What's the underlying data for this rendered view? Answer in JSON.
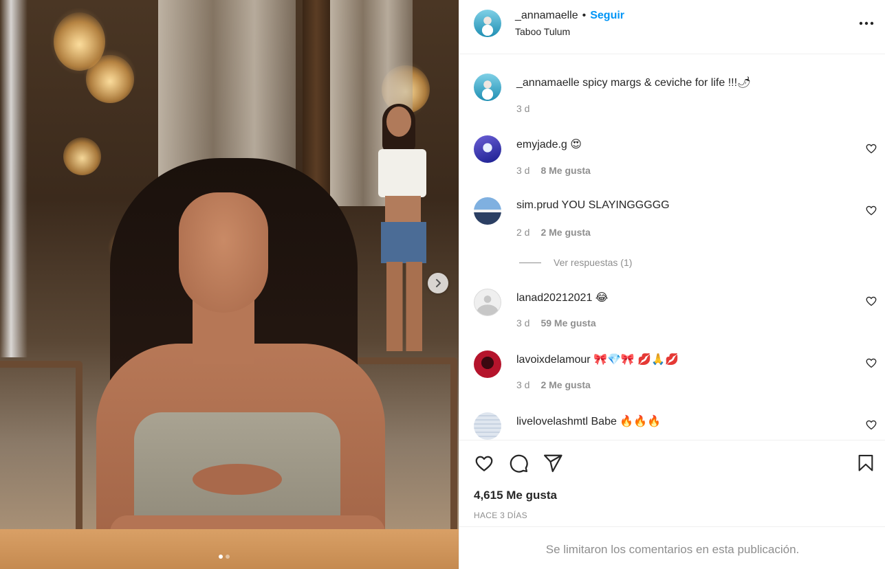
{
  "post": {
    "username": "_annamaelle",
    "separator": "•",
    "follow_label": "Seguir",
    "location": "Taboo Tulum",
    "more_icon": "ellipsis-icon",
    "carousel": {
      "total_images": 2,
      "current_index": 1,
      "next_icon": "chevron-right-icon"
    }
  },
  "caption": {
    "username": "_annamaelle",
    "text": "spicy margs & ceviche for life !!!🌶",
    "time": "3 d"
  },
  "comments": [
    {
      "username": "emyjade.g",
      "text": "😍",
      "time": "3 d",
      "likes": "8 Me gusta"
    },
    {
      "username": "sim.prud",
      "text": "YOU SLAYINGGGGG",
      "time": "2 d",
      "likes": "2 Me gusta",
      "replies_label": "Ver respuestas (1)"
    },
    {
      "username": "lanad20212021",
      "text": "😂",
      "time": "3 d",
      "likes": "59 Me gusta"
    },
    {
      "username": "lavoixdelamour",
      "text": "🎀💎🎀 💋🙏💋",
      "time": "3 d",
      "likes": "2 Me gusta"
    },
    {
      "username": "livelovelashmtl",
      "text": "Babe 🔥🔥🔥",
      "time": "",
      "likes": ""
    }
  ],
  "actions": {
    "like_icon": "heart-icon",
    "comment_icon": "comment-icon",
    "share_icon": "send-icon",
    "save_icon": "bookmark-icon"
  },
  "likes_total": "4,615 Me gusta",
  "time_ago": "HACE 3 DÍAS",
  "footer_message": "Se limitaron los comentarios en esta publicación.",
  "colors": {
    "follow_blue": "#0095f6",
    "text_primary": "#262626",
    "text_secondary": "#8e8e8e",
    "divider": "#efefef"
  }
}
